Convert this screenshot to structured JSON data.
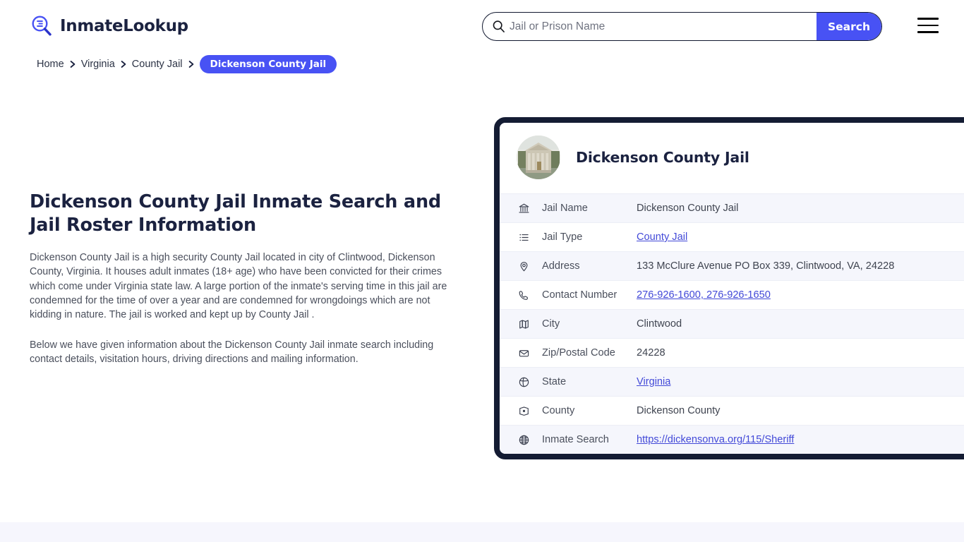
{
  "brand": {
    "name": "InmateLookup",
    "icon": "search-list-logo-icon"
  },
  "search": {
    "placeholder": "Jail or Prison Name",
    "value": "",
    "button_label": "Search",
    "icon": "search-icon"
  },
  "menu": {
    "icon": "hamburger-menu-icon"
  },
  "breadcrumb": {
    "items": [
      {
        "label": "Home",
        "current": false
      },
      {
        "label": "Virginia",
        "current": false
      },
      {
        "label": "County Jail",
        "current": false
      },
      {
        "label": "Dickenson County Jail",
        "current": true
      }
    ],
    "separator": "›"
  },
  "main": {
    "title": "Dickenson County Jail Inmate Search and Jail Roster Information",
    "paragraph1": "Dickenson County Jail is a high security County Jail located in city of Clintwood, Dickenson County, Virginia. It houses adult inmates (18+ age) who have been convicted for their crimes which come under Virginia state law. A large portion of the inmate's serving time in this jail are condemned for the time of over a year and are condemned for wrongdoings which are not kidding in nature. The jail is worked and kept up by County Jail .",
    "paragraph2": "Below we have given information about the Dickenson County Jail inmate search including contact details, visitation hours, driving directions and mailing information."
  },
  "card": {
    "title": "Dickenson County Jail",
    "avatar_icon": "courthouse-photo-avatar",
    "rows": [
      {
        "icon": "bank-icon",
        "label": "Jail Name",
        "value": "Dickenson County Jail",
        "link": false
      },
      {
        "icon": "list-icon",
        "label": "Jail Type",
        "value": "County Jail",
        "link": true
      },
      {
        "icon": "map-pin-icon",
        "label": "Address",
        "value": "133 McClure Avenue PO Box 339, Clintwood, VA, 24228",
        "link": false
      },
      {
        "icon": "phone-icon",
        "label": "Contact Number",
        "value": "276-926-1600, 276-926-1650",
        "link": true
      },
      {
        "icon": "map-icon",
        "label": "City",
        "value": "Clintwood",
        "link": false
      },
      {
        "icon": "envelope-icon",
        "label": "Zip/Postal Code",
        "value": "24228",
        "link": false
      },
      {
        "icon": "compass-icon",
        "label": "State",
        "value": "Virginia",
        "link": true
      },
      {
        "icon": "map-marker-icon",
        "label": "County",
        "value": "Dickenson County",
        "link": false
      },
      {
        "icon": "globe-icon",
        "label": "Inmate Search",
        "value": "https://dickensonva.org/115/Sheriff",
        "link": true
      }
    ]
  },
  "colors": {
    "accent": "#4852f4",
    "dark": "#141c33",
    "link": "#4249d8",
    "row_alt": "#f5f6fc",
    "band": "#f6f6fd"
  }
}
